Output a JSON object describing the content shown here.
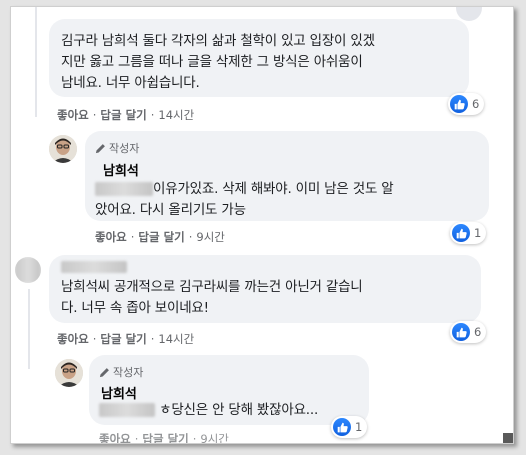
{
  "comments": [
    {
      "lines": [
        "김구라 남희석 둘다 각자의 삶과 철학이 있고 입장이 있겠",
        "지만 옳고 그름을 떠나 글을 삭제한 그 방식은 아쉬움이",
        "남네요. 너무 아쉽습니다."
      ],
      "actions": {
        "like": "좋아요",
        "reply": "답글 달기",
        "time": "14시간"
      },
      "reactions": 6
    },
    {
      "author_badge": "작성자",
      "name": "남희석",
      "line1_after_blur": "이유가있죠. 삭제 해봐야. 이미 남은 것도 알",
      "line2": "았어요. 다시 올리기도 가능",
      "actions": {
        "like": "좋아요",
        "reply": "답글 달기",
        "time": "9시간"
      },
      "reactions": 1
    },
    {
      "lines": [
        "남희석씨 공개적으로 김구라씨를 까는건 아닌거 같습니",
        "다. 너무 속 좁아 보이네요!"
      ],
      "actions": {
        "like": "좋아요",
        "reply": "답글 달기",
        "time": "14시간"
      },
      "reactions": 6
    },
    {
      "author_badge": "작성자",
      "name": "남희석",
      "line1_after_blur": "ㅎ당신은 안 당해 봤잖아요...",
      "actions": {
        "like": "좋아요",
        "reply": "답글 달기",
        "time": "9시간"
      },
      "reactions": 1
    }
  ],
  "separator": "·",
  "icons": {
    "like": "thumbs-up-icon",
    "badge": "pencil-icon",
    "avatar": "avatar-icon"
  },
  "colors": {
    "like_blue": "#1877f2",
    "bubble": "#f0f2f5",
    "meta": "#65676b"
  }
}
